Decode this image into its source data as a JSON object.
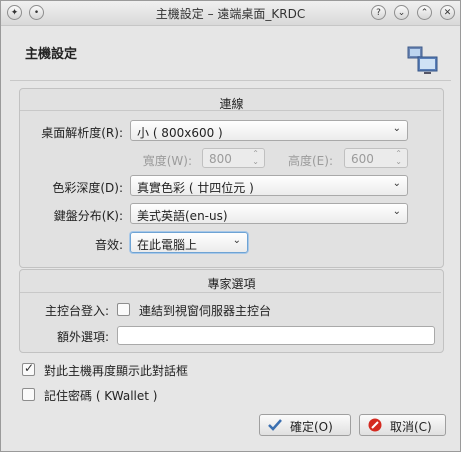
{
  "window": {
    "title": "主機設定 – 遠端桌面_KRDC"
  },
  "header": {
    "title": "主機設定"
  },
  "connection": {
    "group_title": "連線",
    "resolution_label": "桌面解析度(R):",
    "resolution_value": "小 ( 800x600 )",
    "width_label": "寬度(W):",
    "width_value": "800",
    "height_label": "高度(E):",
    "height_value": "600",
    "color_label": "色彩深度(D):",
    "color_value": "真實色彩 ( 廿四位元 )",
    "keyboard_label": "鍵盤分布(K):",
    "keyboard_value": "美式英語(en-us)",
    "sound_label": "音效:",
    "sound_value": "在此電腦上"
  },
  "expert": {
    "group_title": "專家選項",
    "console_label": "主控台登入:",
    "console_checkbox_label": "連結到視窗伺服器主控台",
    "console_checked": false,
    "extra_label": "額外選項:",
    "extra_value": ""
  },
  "options": {
    "show_again_label": "對此主機再度顯示此對話框",
    "show_again_checked": true,
    "remember_password_label": "記住密碼 ( KWallet )",
    "remember_password_checked": false
  },
  "buttons": {
    "ok_label": "確定(O)",
    "cancel_label": "取消(C)"
  },
  "colors": {
    "focus_border": "#6ea3d4",
    "cancel_icon": "#d42a20",
    "ok_icon": "#3a6fb0"
  }
}
